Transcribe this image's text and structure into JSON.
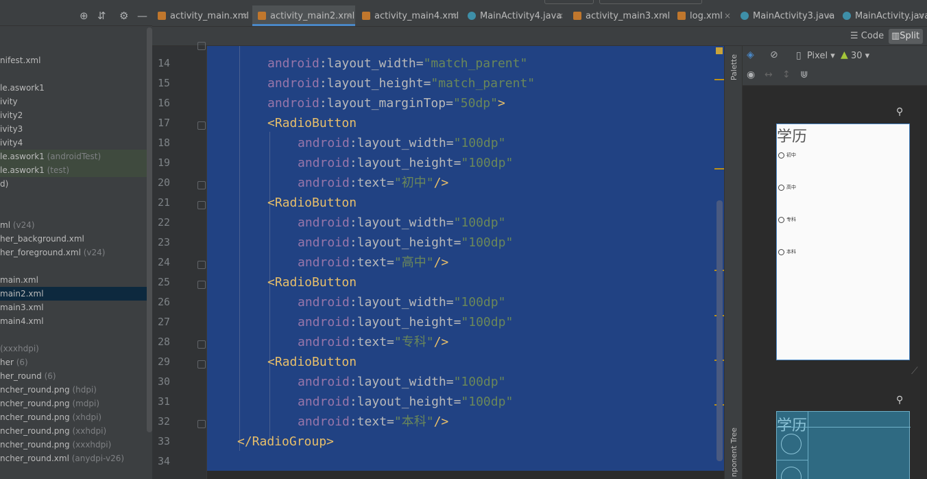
{
  "tabs": [
    {
      "label": "activity_main.xml",
      "kind": "xml",
      "active": false
    },
    {
      "label": "activity_main2.xml",
      "kind": "xml",
      "active": true
    },
    {
      "label": "activity_main4.xml",
      "kind": "xml",
      "active": false
    },
    {
      "label": "MainActivity4.java",
      "kind": "java",
      "active": false
    },
    {
      "label": "activity_main3.xml",
      "kind": "xml",
      "active": false
    },
    {
      "label": "log.xml",
      "kind": "xml",
      "active": false
    },
    {
      "label": "MainActivity3.java",
      "kind": "java",
      "active": false
    },
    {
      "label": "MainActivity.java",
      "kind": "java",
      "active": false
    }
  ],
  "tab_close": "×",
  "view_modes": {
    "code": "Code",
    "split": "Split"
  },
  "tree": [
    {
      "text": "nifest.xml",
      "suffix": "",
      "style": ""
    },
    {
      "text": "",
      "suffix": "",
      "style": ""
    },
    {
      "text": "le.aswork1",
      "suffix": "",
      "style": ""
    },
    {
      "text": "ivity",
      "suffix": "",
      "style": ""
    },
    {
      "text": "ivity2",
      "suffix": "",
      "style": ""
    },
    {
      "text": "ivity3",
      "suffix": "",
      "style": ""
    },
    {
      "text": "ivity4",
      "suffix": "",
      "style": ""
    },
    {
      "text": "le.aswork1",
      "suffix": " (androidTest)",
      "style": "test"
    },
    {
      "text": "le.aswork1",
      "suffix": " (test)",
      "style": "test"
    },
    {
      "text": "d)",
      "suffix": "",
      "style": ""
    },
    {
      "text": "",
      "suffix": "",
      "style": ""
    },
    {
      "text": "",
      "suffix": "",
      "style": ""
    },
    {
      "text": "ml",
      "suffix": " (v24)",
      "style": ""
    },
    {
      "text": "her_background.xml",
      "suffix": "",
      "style": ""
    },
    {
      "text": "her_foreground.xml",
      "suffix": " (v24)",
      "style": ""
    },
    {
      "text": "",
      "suffix": "",
      "style": ""
    },
    {
      "text": "main.xml",
      "suffix": "",
      "style": ""
    },
    {
      "text": "main2.xml",
      "suffix": "",
      "style": "sel"
    },
    {
      "text": "main3.xml",
      "suffix": "",
      "style": ""
    },
    {
      "text": "main4.xml",
      "suffix": "",
      "style": ""
    },
    {
      "text": "",
      "suffix": "",
      "style": ""
    },
    {
      "text": "",
      "suffix": " (xxxhdpi)",
      "style": ""
    },
    {
      "text": "her",
      "suffix": " (6)",
      "style": ""
    },
    {
      "text": "her_round",
      "suffix": " (6)",
      "style": ""
    },
    {
      "text": "ncher_round.png",
      "suffix": " (hdpi)",
      "style": ""
    },
    {
      "text": "ncher_round.png",
      "suffix": " (mdpi)",
      "style": ""
    },
    {
      "text": "ncher_round.png",
      "suffix": " (xhdpi)",
      "style": ""
    },
    {
      "text": "ncher_round.png",
      "suffix": " (xxhdpi)",
      "style": ""
    },
    {
      "text": "ncher_round.png",
      "suffix": " (xxxhdpi)",
      "style": ""
    },
    {
      "text": "ncher_round.xml",
      "suffix": " (anydpi-v26)",
      "style": ""
    }
  ],
  "line_numbers": [
    "14",
    "15",
    "16",
    "17",
    "18",
    "19",
    "20",
    "21",
    "22",
    "23",
    "24",
    "25",
    "26",
    "27",
    "28",
    "29",
    "30",
    "31",
    "32",
    "33",
    "34"
  ],
  "code": {
    "l14": {
      "ns": "android",
      "attr": ":layout_width=",
      "val": "\"match_parent\""
    },
    "l15": {
      "ns": "android",
      "attr": ":layout_height=",
      "val": "\"match_parent\""
    },
    "l16": {
      "ns": "android",
      "attr": ":layout_marginTop=",
      "val": "\"50dp\"",
      "end": ">"
    },
    "open_tag": "<RadioButton",
    "rb_width": {
      "ns": "android",
      "attr": ":layout_width=",
      "val": "\"100dp\""
    },
    "rb_height": {
      "ns": "android",
      "attr": ":layout_height=",
      "val": "\"100dp\""
    },
    "text_attr": {
      "ns": "android",
      "attr": ":text="
    },
    "self_close": "/>",
    "texts": [
      "\"初中\"",
      "\"高中\"",
      "\"专科\"",
      "\"本科\""
    ],
    "close_group": "</RadioGroup>"
  },
  "design": {
    "device": "Pixel",
    "api": "30",
    "palette_label": "Palette",
    "tree_label": "nponent Tree",
    "preview_title": "学历",
    "options": [
      "初中",
      "高中",
      "专科",
      "本科"
    ]
  }
}
